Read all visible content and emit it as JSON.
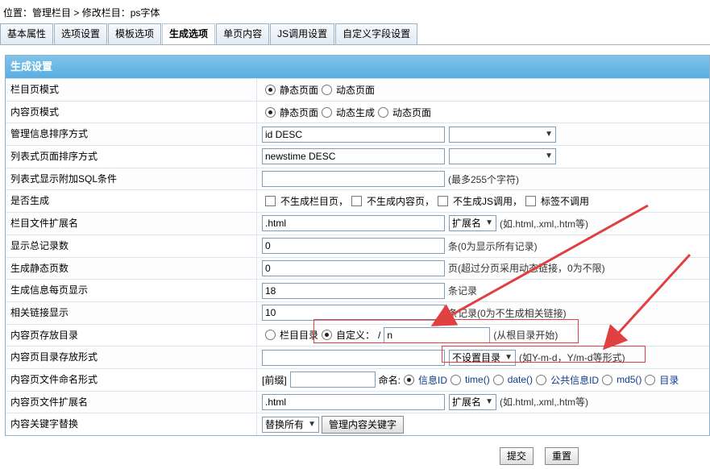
{
  "breadcrumb": {
    "prefix": "位置：",
    "link": "管理栏目",
    "sep": " > ",
    "current": "修改栏目：ps字体"
  },
  "tabs": [
    "基本属性",
    "选项设置",
    "模板选项",
    "生成选项",
    "单页内容",
    "JS调用设置",
    "自定义字段设置"
  ],
  "section_title": "生成设置",
  "rows": {
    "list_mode": {
      "label": "栏目页模式",
      "opt1": "静态页面",
      "opt2": "动态页面"
    },
    "content_mode": {
      "label": "内容页模式",
      "opt1": "静态页面",
      "opt2": "动态生成",
      "opt3": "动态页面"
    },
    "manage_sort": {
      "label": "管理信息排序方式",
      "value": "id DESC"
    },
    "list_sort": {
      "label": "列表式页面排序方式",
      "value": "newstime DESC"
    },
    "list_sql": {
      "label": "列表式显示附加SQL条件",
      "value": "",
      "hint": "(最多255个字符)"
    },
    "is_generate": {
      "label": "是否生成",
      "c1": "不生成栏目页，",
      "c2": "不生成内容页，",
      "c3": "不生成JS调用，",
      "c4": "标签不调用"
    },
    "list_ext": {
      "label": "栏目文件扩展名",
      "value": ".html",
      "select": "扩展名",
      "hint": "(如.html,.xml,.htm等)"
    },
    "total_records": {
      "label": "显示总记录数",
      "value": "0",
      "hint": "条(0为显示所有记录)"
    },
    "static_pages": {
      "label": "生成静态页数",
      "value": "0",
      "hint": "页(超过分页采用动态链接，0为不限)"
    },
    "per_page": {
      "label": "生成信息每页显示",
      "value": "18",
      "hint": "条记录"
    },
    "related_links": {
      "label": "相关链接显示",
      "value": "10",
      "hint": "条记录(0为不生成相关链接)"
    },
    "content_dir": {
      "label": "内容页存放目录",
      "opt1": "栏目目录",
      "opt2": "自定义：",
      "slash": "/",
      "value": "n",
      "hint": "(从根目录开始)"
    },
    "dir_format": {
      "label": "内容页目录存放形式",
      "value": "",
      "select": "不设置目录",
      "hint": "(如Y-m-d，Y/m-d等形式)"
    },
    "file_naming": {
      "label": "内容页文件命名形式",
      "prefix_label": "[前缀]",
      "prefix_value": "",
      "name_label": "命名:",
      "o1": "信息ID",
      "o2": "time()",
      "o3": "date()",
      "o4": "公共信息ID",
      "o5": "md5()",
      "o6": "目录"
    },
    "content_ext": {
      "label": "内容页文件扩展名",
      "value": ".html",
      "select": "扩展名",
      "hint": "(如.html,.xml,.htm等)"
    },
    "keyword_replace": {
      "label": "内容关键字替换",
      "select": "替换所有",
      "button": "管理内容关键字"
    }
  },
  "footer": {
    "submit": "提交",
    "reset": "重置"
  },
  "colors": {
    "header": "#5aaee0",
    "annotation": "#e04040"
  }
}
